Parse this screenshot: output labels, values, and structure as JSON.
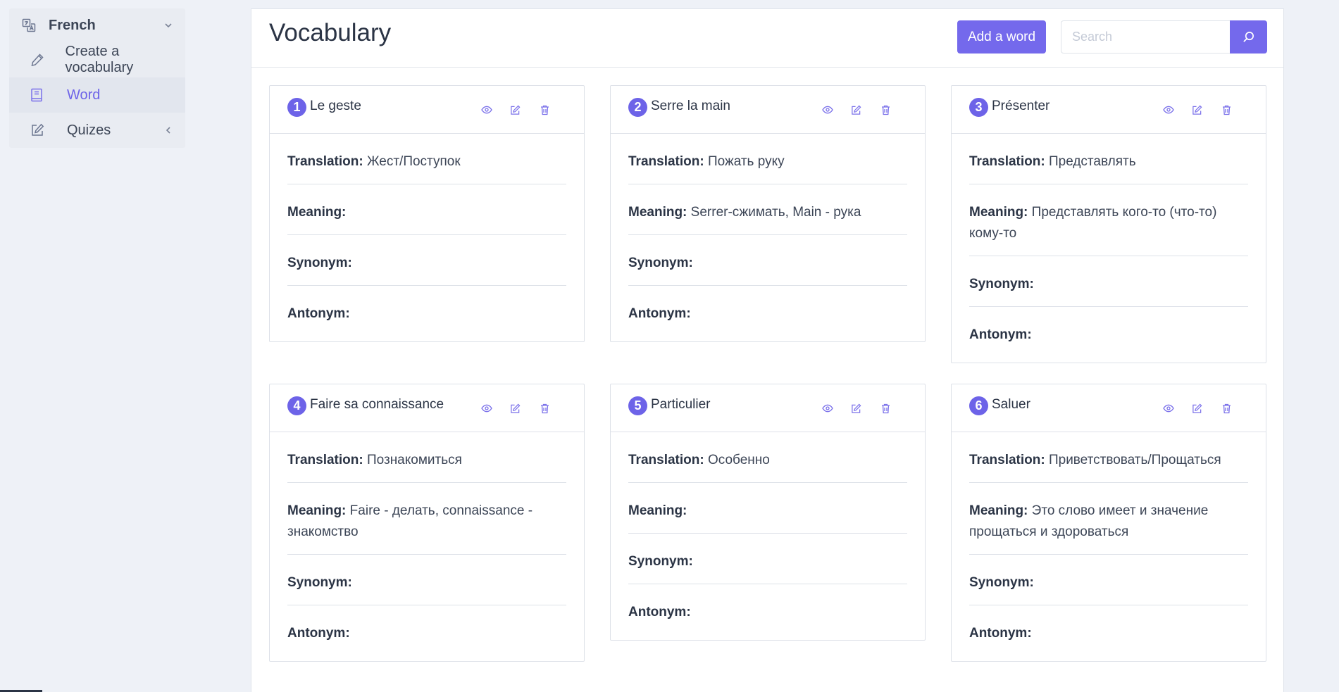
{
  "sidebar": {
    "language": "French",
    "items": [
      {
        "label": "Create a vocabulary"
      },
      {
        "label": "Word"
      },
      {
        "label": "Quizes"
      }
    ]
  },
  "header": {
    "title": "Vocabulary",
    "add_label": "Add a word",
    "search_placeholder": "Search"
  },
  "labels": {
    "translation": "Translation:",
    "meaning": "Meaning:",
    "synonym": "Synonym:",
    "antonym": "Antonym:"
  },
  "cards": [
    {
      "num": "1",
      "word": "Le geste",
      "translation": "Жест/Поступок",
      "meaning": "",
      "synonym": "",
      "antonym": ""
    },
    {
      "num": "2",
      "word": "Serre la main",
      "translation": "Пожать руку",
      "meaning": "Serrer-сжимать, Main - рука",
      "synonym": "",
      "antonym": ""
    },
    {
      "num": "3",
      "word": "Présenter",
      "translation": "Представлять",
      "meaning": "Представлять кого-то (что-то) кому-то",
      "synonym": "",
      "antonym": ""
    },
    {
      "num": "4",
      "word": "Faire sa connaissance",
      "translation": "Познакомиться",
      "meaning": "Faire - делать, connaissance - знакомство",
      "synonym": "",
      "antonym": ""
    },
    {
      "num": "5",
      "word": "Particulier",
      "translation": "Особенно",
      "meaning": "",
      "synonym": "",
      "antonym": ""
    },
    {
      "num": "6",
      "word": "Saluer",
      "translation": "Приветствовать/Прощаться",
      "meaning": "Это слово имеет и значение прощаться и здороваться",
      "synonym": "",
      "antonym": ""
    }
  ],
  "colors": {
    "accent": "#7469ec",
    "background": "#eef1f7"
  },
  "icons": {
    "view": "eye-icon",
    "edit": "edit-icon",
    "delete": "trash-icon",
    "search": "search-icon"
  }
}
